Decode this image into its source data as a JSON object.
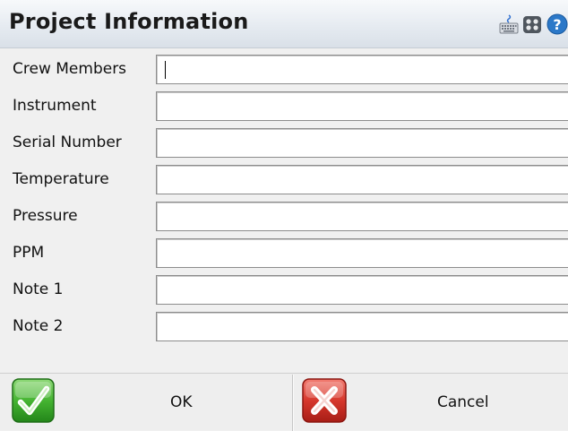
{
  "window": {
    "title": "Project Information"
  },
  "title_icons": {
    "keyboard": "keyboard-icon",
    "grid": "grid-icon",
    "help": "help-icon",
    "help_glyph": "?"
  },
  "form": {
    "fields": [
      {
        "label": "Crew Members",
        "value": ""
      },
      {
        "label": "Instrument",
        "value": ""
      },
      {
        "label": "Serial Number",
        "value": ""
      },
      {
        "label": "Temperature",
        "value": ""
      },
      {
        "label": "Pressure",
        "value": ""
      },
      {
        "label": "PPM",
        "value": ""
      },
      {
        "label": "Note 1",
        "value": ""
      },
      {
        "label": "Note 2",
        "value": ""
      }
    ],
    "focused_field": "Crew Members"
  },
  "buttons": {
    "ok_label": "OK",
    "cancel_label": "Cancel",
    "ok_icon": "checkmark-icon",
    "cancel_icon": "red-x-icon"
  },
  "colors": {
    "ok_green": "#3aa82c",
    "cancel_red": "#d22b24",
    "help_blue": "#2b78c8"
  }
}
